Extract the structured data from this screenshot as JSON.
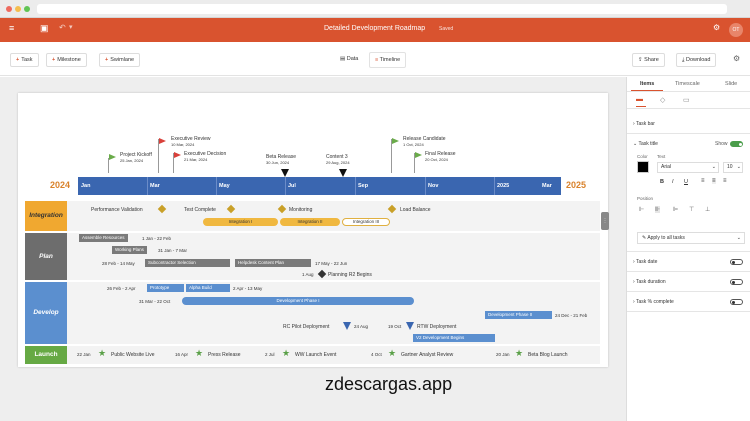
{
  "colors": {
    "accent": "#d9532f",
    "timescale": "#3a66b0",
    "integration": "#f0a830",
    "plan": "#6d6d6d",
    "develop": "#5b8fcf",
    "launch": "#66a944",
    "milestone_gold": "#c9a028"
  },
  "app": {
    "title": "Detailed Development Roadmap",
    "saved": "Saved",
    "avatar": "OT"
  },
  "toolbar": {
    "task": "Task",
    "milestone": "Milestone",
    "swimlane": "Swimlane",
    "data": "Data",
    "timeline": "Timeline",
    "share": "Share",
    "download": "Download"
  },
  "panel": {
    "tabs": [
      "Items",
      "Timescale",
      "Slide"
    ],
    "task_bar": "Task bar",
    "task_title": "Task title",
    "show": "Show",
    "color": "Color",
    "text": "Text",
    "font": "Arial",
    "size": "10",
    "bold": "B",
    "italic": "I",
    "underline": "U",
    "position": "Position",
    "apply": "Apply to all tasks",
    "task_date": "Task date",
    "task_duration": "Task duration",
    "task_complete": "Task % complete"
  },
  "timeline": {
    "year_start": "2024",
    "year_end": "2025",
    "months": [
      "Jan",
      "Mar",
      "May",
      "Jul",
      "Sep",
      "Nov",
      "2025",
      "Mar"
    ]
  },
  "milestones_top": [
    {
      "title": "Project Kickoff",
      "date": "25 Jan, 2024"
    },
    {
      "title": "Executive Review",
      "date": "10 Mar, 2024"
    },
    {
      "title": "Executive Decision",
      "date": "21 Mar, 2024"
    },
    {
      "title": "Beta Release",
      "date": "30 Jun, 2024"
    },
    {
      "title": "Content 3",
      "date": "29 Aug, 2024"
    },
    {
      "title": "Release Candidate",
      "date": "1 Oct, 2024"
    },
    {
      "title": "Final Release",
      "date": "20 Oct, 2024"
    }
  ],
  "swimlanes": {
    "integration": "Integration",
    "plan": "Plan",
    "develop": "Develop",
    "launch": "Launch"
  },
  "integration": {
    "performance": "Performance Validation",
    "test": "Test Complete",
    "monitoring": "Monitoring",
    "load": "Load Balance",
    "int1": "Integration I",
    "int2": "Integration II",
    "int3": "Integration III"
  },
  "plan": {
    "assemble": "Assemble Resources",
    "assemble_dates": "1 Jan - 22 Feb",
    "working": "Working Plans",
    "working_dates": "31 Jan - 7 Mar",
    "sub_dates": "28 Feb - 14 May",
    "sub": "Subcontractor Selection",
    "helpdesk": "Helpdesk Content Plan",
    "helpdesk_dates": "17 May - 22 Jun",
    "r2_date": "1 Aug",
    "r2": "Planning R2 Begins"
  },
  "develop": {
    "proto_dates": "26 Feb - 2 Apr",
    "prototype": "Prototype",
    "alpha": "Alpha Build",
    "alpha_dates": "2 Apr - 13 May",
    "phase1_dates": "31 Mar - 22 Oct",
    "phase1": "Development Phase I",
    "phase2": "Development Phase II",
    "phase2_dates": "24 Dec - 21 Feb",
    "rc_deploy": "RC Pilot Deployment",
    "rc_date": "24 Aug",
    "rtw_date": "19 Oct",
    "rtw": "RTW Deployment",
    "v2": "V2 Development Begins"
  },
  "launch": {
    "items": [
      {
        "date": "22 Jan",
        "label": "Public Website Live"
      },
      {
        "date": "16 Apr",
        "label": "Press Release"
      },
      {
        "date": "2 Jul",
        "label": "WW Launch Event"
      },
      {
        "date": "4 Oct",
        "label": "Gartner Analyst Review"
      },
      {
        "date": "20 Jan",
        "label": "Beta Blog Launch"
      }
    ]
  },
  "watermark": "zdescargas.app"
}
